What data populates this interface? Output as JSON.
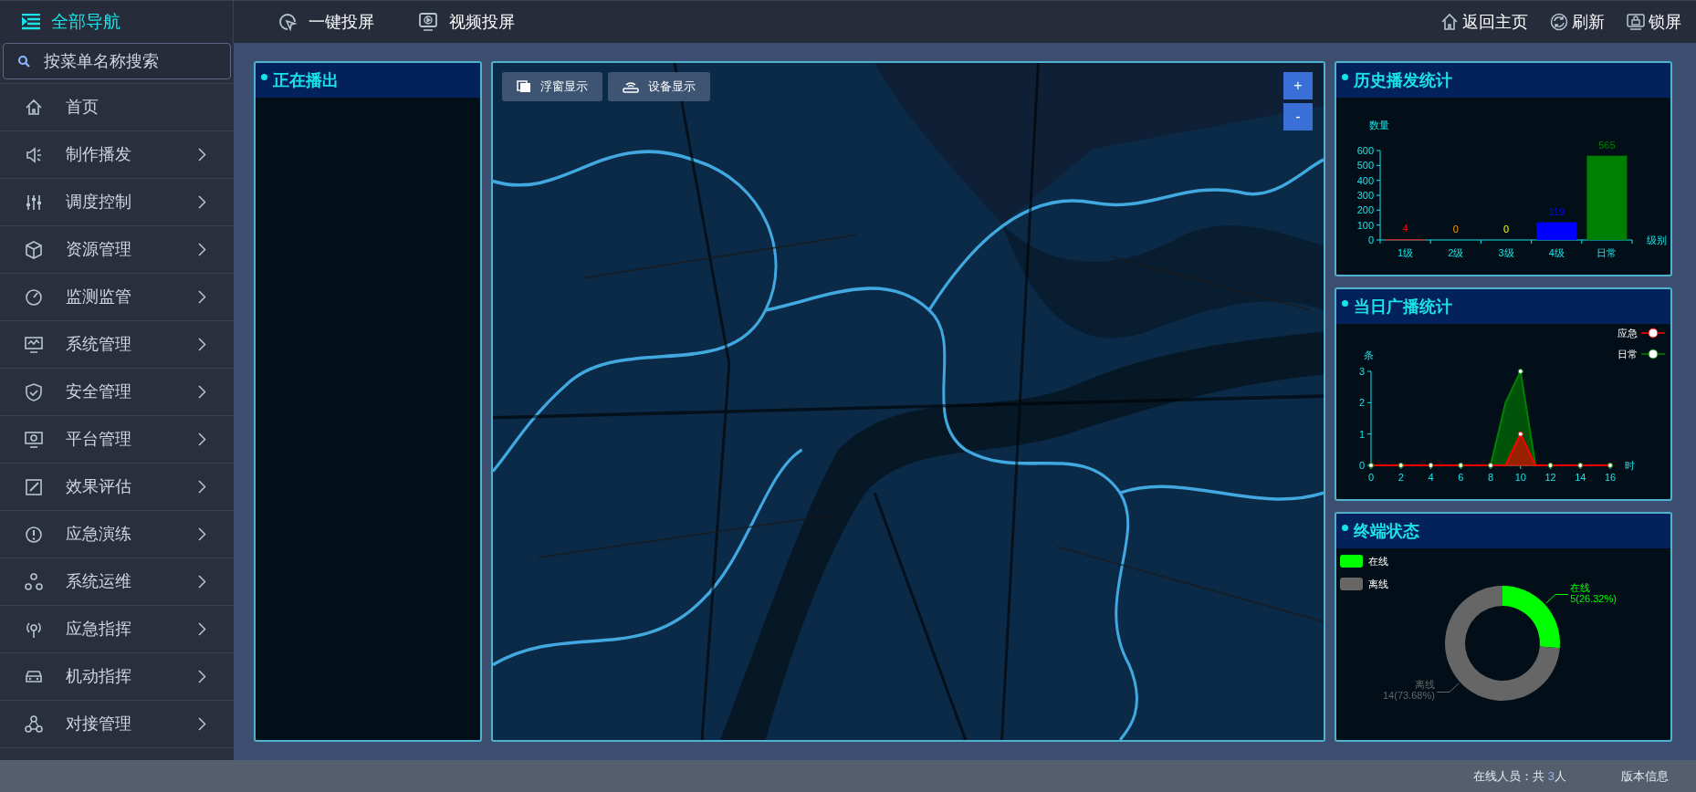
{
  "nav": {
    "title": "全部导航",
    "search": {
      "placeholder": "按菜单名称搜索"
    },
    "items": [
      {
        "label": "首页",
        "expandable": false
      },
      {
        "label": "制作播发",
        "expandable": true
      },
      {
        "label": "调度控制",
        "expandable": true
      },
      {
        "label": "资源管理",
        "expandable": true
      },
      {
        "label": "监测监管",
        "expandable": true
      },
      {
        "label": "系统管理",
        "expandable": true
      },
      {
        "label": "安全管理",
        "expandable": true
      },
      {
        "label": "平台管理",
        "expandable": true
      },
      {
        "label": "效果评估",
        "expandable": true
      },
      {
        "label": "应急演练",
        "expandable": true
      },
      {
        "label": "系统运维",
        "expandable": true
      },
      {
        "label": "应急指挥",
        "expandable": true
      },
      {
        "label": "机动指挥",
        "expandable": true
      },
      {
        "label": "对接管理",
        "expandable": true
      }
    ]
  },
  "toolbar": {
    "left": [
      "一键投屏",
      "视频投屏"
    ],
    "right": [
      "返回主页",
      "刷新",
      "锁屏"
    ]
  },
  "now_playing": {
    "title": "正在播出"
  },
  "map": {
    "kind": "picture",
    "buttons": [
      "浮窗显示",
      "设备显示"
    ],
    "zoom_in": "+",
    "zoom_out": "-"
  },
  "history": {
    "title": "历史播发统计",
    "chart_data": {
      "type": "bar",
      "xlabel": "级别",
      "ylabel": "数量",
      "categories": [
        "1级",
        "2级",
        "3级",
        "4级",
        "日常"
      ],
      "series": [
        {
          "color": "#ff0000",
          "values": [
            4,
            null,
            null,
            null,
            null
          ]
        },
        {
          "color": "#ff9900",
          "values": [
            null,
            0,
            null,
            null,
            null
          ]
        },
        {
          "color": "#ffff00",
          "values": [
            null,
            null,
            0,
            null,
            null
          ]
        },
        {
          "color": "#0000ff",
          "values": [
            null,
            null,
            null,
            119,
            null
          ]
        },
        {
          "color": "#008000",
          "values": [
            null,
            null,
            null,
            null,
            565
          ]
        }
      ],
      "ylim": [
        0,
        600
      ],
      "yticks": [
        0,
        100,
        200,
        300,
        400,
        500,
        600
      ],
      "data_labels": true
    }
  },
  "today": {
    "title": "当日广播统计",
    "chart_data": {
      "type": "area",
      "xlabel": "时",
      "ylabel": "条",
      "x": [
        0,
        1,
        2,
        3,
        4,
        5,
        6,
        7,
        8,
        9,
        10,
        11,
        12,
        13,
        14,
        15,
        16
      ],
      "series": [
        {
          "name": "应急",
          "color": "#ff0000",
          "values": [
            0,
            0,
            0,
            0,
            0,
            0,
            0,
            0,
            0,
            0,
            1,
            0,
            0,
            0,
            0,
            0,
            0
          ]
        },
        {
          "name": "日常",
          "color": "#008000",
          "values": [
            0,
            0,
            0,
            0,
            0,
            0,
            0,
            0,
            0,
            2,
            3,
            0,
            0,
            0,
            0,
            0,
            0
          ]
        }
      ],
      "xlim": [
        0,
        16
      ],
      "ylim": [
        0,
        3
      ],
      "xticks": [
        0,
        2,
        4,
        6,
        8,
        10,
        12,
        14,
        16
      ],
      "yticks": [
        0,
        1,
        2,
        3
      ],
      "legend": true
    }
  },
  "terminals": {
    "title": "终端状态",
    "chart_data": {
      "type": "donut",
      "categories": [
        "在线",
        "离线"
      ],
      "series": [
        {
          "values": [
            26.32,
            73.68
          ]
        }
      ],
      "colors": [
        "#00ff00",
        "#666666"
      ],
      "value_labels": [
        "5(26.32%)",
        "14(73.68%)"
      ],
      "legend": true
    }
  },
  "status_bar": {
    "online_label": "在线人员：共",
    "online_count": "3",
    "online_unit": "人",
    "version": "版本信息"
  }
}
